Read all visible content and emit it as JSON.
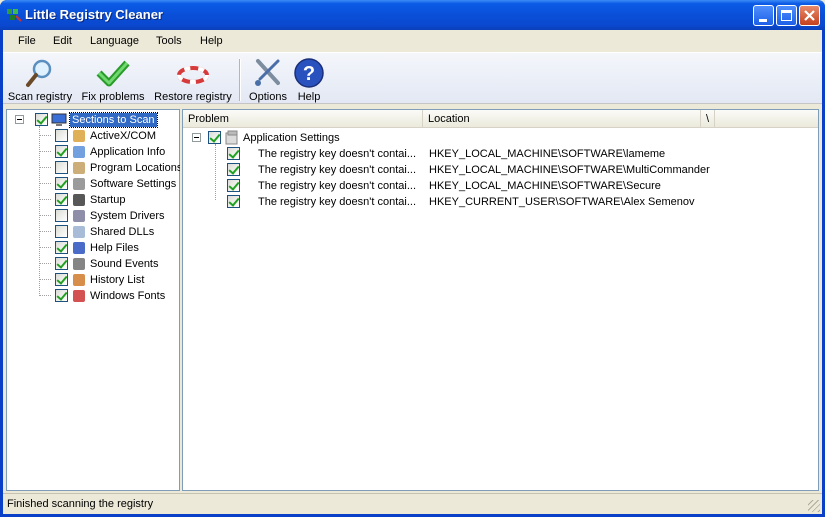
{
  "window": {
    "title": "Little Registry Cleaner",
    "icon": "registry-cleaner-icon"
  },
  "menu": [
    "File",
    "Edit",
    "Language",
    "Tools",
    "Help"
  ],
  "toolbar": {
    "scan_label": "Scan registry",
    "fix_label": "Fix problems",
    "restore_label": "Restore registry",
    "options_label": "Options",
    "help_label": "Help"
  },
  "sections": {
    "root_label": "Sections to Scan",
    "items": [
      {
        "label": "ActiveX/COM",
        "checked": false,
        "icon": "activex-icon"
      },
      {
        "label": "Application Info",
        "checked": true,
        "icon": "application-info-icon"
      },
      {
        "label": "Program Locations",
        "checked": false,
        "icon": "program-locations-icon"
      },
      {
        "label": "Software Settings",
        "checked": true,
        "icon": "software-settings-icon"
      },
      {
        "label": "Startup",
        "checked": true,
        "icon": "startup-icon"
      },
      {
        "label": "System Drivers",
        "checked": false,
        "icon": "system-drivers-icon"
      },
      {
        "label": "Shared DLLs",
        "checked": false,
        "icon": "shared-dlls-icon"
      },
      {
        "label": "Help Files",
        "checked": true,
        "icon": "help-files-icon"
      },
      {
        "label": "Sound Events",
        "checked": true,
        "icon": "sound-events-icon"
      },
      {
        "label": "History List",
        "checked": true,
        "icon": "history-list-icon"
      },
      {
        "label": "Windows Fonts",
        "checked": true,
        "icon": "windows-fonts-icon"
      }
    ]
  },
  "results": {
    "columns": [
      "Problem",
      "Location",
      "\\"
    ],
    "group_label": "Application Settings",
    "rows": [
      {
        "problem": "The registry key doesn't contai...",
        "location": "HKEY_LOCAL_MACHINE\\SOFTWARE\\lameme"
      },
      {
        "problem": "The registry key doesn't contai...",
        "location": "HKEY_LOCAL_MACHINE\\SOFTWARE\\MultiCommander"
      },
      {
        "problem": "The registry key doesn't contai...",
        "location": "HKEY_LOCAL_MACHINE\\SOFTWARE\\Secure"
      },
      {
        "problem": "The registry key doesn't contai...",
        "location": "HKEY_CURRENT_USER\\SOFTWARE\\Alex Semenov"
      }
    ]
  },
  "status": "Finished scanning the registry"
}
